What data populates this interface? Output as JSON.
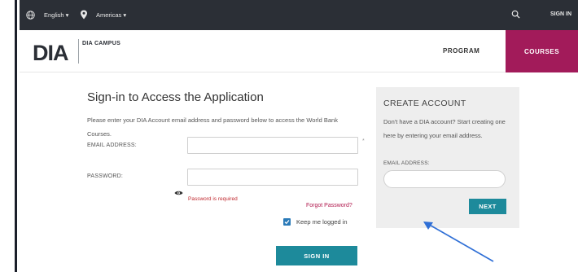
{
  "topbar": {
    "language": "English ▾",
    "region": "Americas ▾",
    "signin": "SIGN IN",
    "icons": [
      "globe-icon",
      "location-pin-icon",
      "search-icon"
    ]
  },
  "header": {
    "logo_text": "DIA",
    "campus": "DIA CAMPUS",
    "nav": {
      "program": "PROGRAM",
      "courses": "COURSES"
    },
    "colors": {
      "courses_bg": "#a21b5a",
      "logo_accent": "#7ab648"
    }
  },
  "signin_form": {
    "title": "Sign-in to Access the Application",
    "intro": "Please enter your DIA Account email address and password below to access the World Bank Courses.",
    "email_label": "EMAIL ADDRESS:",
    "email_value": "",
    "email_required_mark": "*",
    "password_label": "PASSWORD:",
    "password_value": "",
    "password_error": "Password is required",
    "forgot_link": "Forgot Password?",
    "keep_logged_in": "Keep me logged in",
    "keep_logged_in_checked": true,
    "submit": "SIGN IN"
  },
  "create_account": {
    "title": "CREATE ACCOUNT",
    "text": "Don't have a DIA account? Start creating one here by entering your email address.",
    "email_label": "EMAIL ADDRESS:",
    "email_value": "",
    "next": "NEXT"
  },
  "colors": {
    "topbar_bg": "#2b2f36",
    "button_teal": "#1d8a9b",
    "error_red": "#c0292f",
    "arrow_blue": "#2f6fd6"
  }
}
